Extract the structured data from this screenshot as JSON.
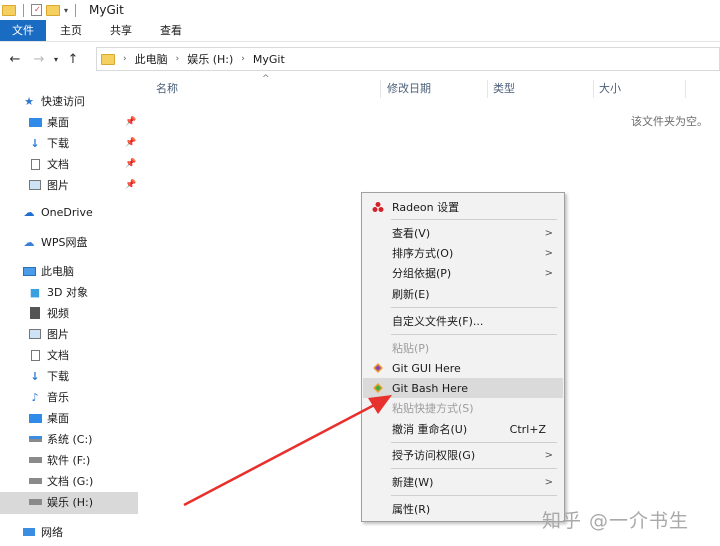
{
  "window": {
    "title": "MyGit"
  },
  "ribbon": {
    "tabs": [
      "文件",
      "主页",
      "共享",
      "查看"
    ]
  },
  "address": {
    "path": [
      "此电脑",
      "娱乐 (H:)",
      "MyGit"
    ]
  },
  "sidebar": {
    "quick_access": "快速访问",
    "quick_items": [
      "桌面",
      "下载",
      "文档",
      "图片"
    ],
    "onedrive": "OneDrive",
    "wps": "WPS网盘",
    "this_pc": "此电脑",
    "pc_items": [
      "3D 对象",
      "视频",
      "图片",
      "文档",
      "下载",
      "音乐",
      "桌面",
      "系统 (C:)",
      "软件 (F:)",
      "文档 (G:)",
      "娱乐 (H:)"
    ],
    "network": "网络"
  },
  "columns": [
    "名称",
    "修改日期",
    "类型",
    "大小"
  ],
  "empty_message": "该文件夹为空。",
  "context_menu": {
    "radeon": "Radeon 设置",
    "view": "查看(V)",
    "sort": "排序方式(O)",
    "group": "分组依据(P)",
    "refresh": "刷新(E)",
    "customize": "自定义文件夹(F)...",
    "paste": "粘贴(P)",
    "git_gui": "Git GUI Here",
    "git_bash": "Git Bash Here",
    "paste_shortcut": "粘贴快捷方式(S)",
    "undo": "撤消 重命名(U)",
    "undo_shortcut": "Ctrl+Z",
    "grant_access": "授予访问权限(G)",
    "new": "新建(W)",
    "properties": "属性(R)"
  },
  "watermark": "知乎 @一介书生",
  "colors": {
    "accent": "#1a6bc2",
    "annotation_arrow": "#e8302c",
    "folder": "#f5cf60"
  }
}
